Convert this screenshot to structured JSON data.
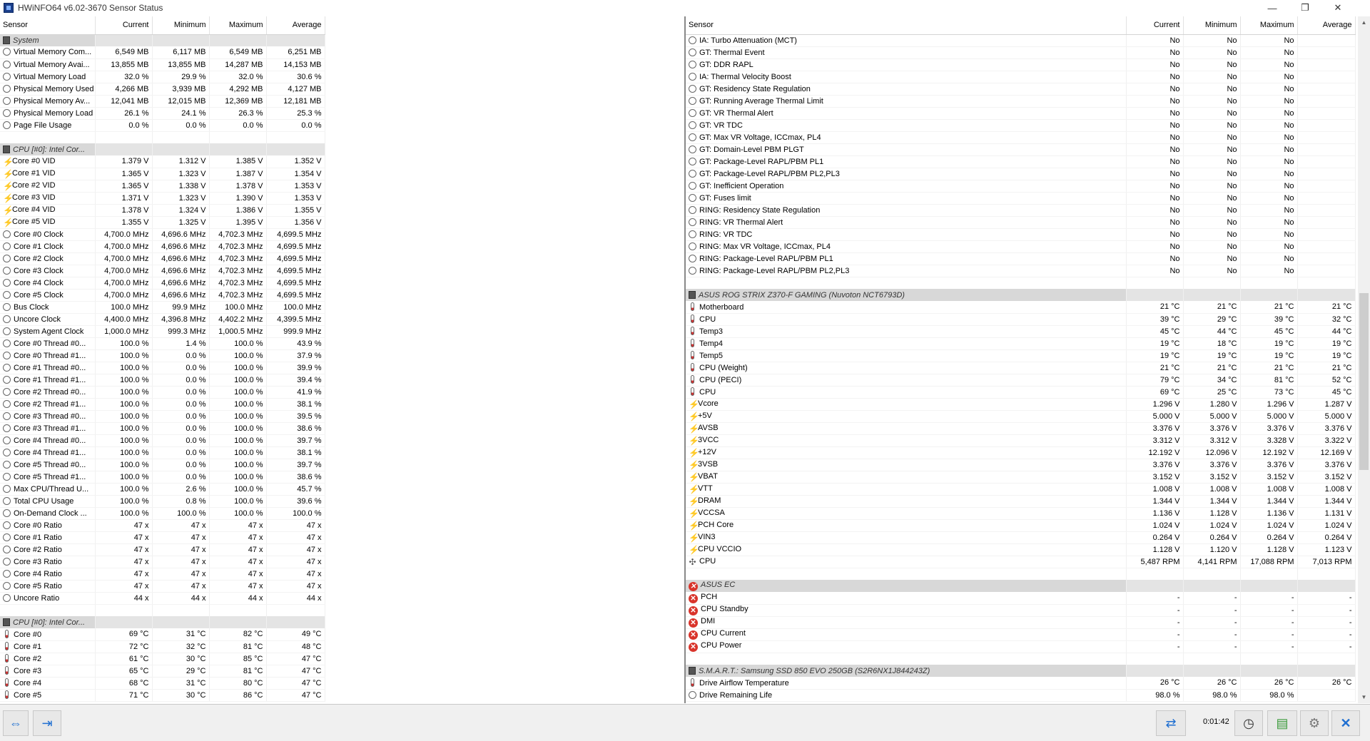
{
  "window": {
    "title": "HWiNFO64 v6.02-3670 Sensor Status",
    "minimize_glyph": "—",
    "maximize_glyph": "❐",
    "close_glyph": "✕"
  },
  "columns": {
    "sensor": "Sensor",
    "current": "Current",
    "minimum": "Minimum",
    "maximum": "Maximum",
    "average": "Average"
  },
  "left_rows": [
    {
      "type": "group",
      "icon": "chip",
      "name": "System"
    },
    {
      "type": "row",
      "icon": "circle",
      "name": "Virtual Memory Com...",
      "cur": "6,549 MB",
      "min": "6,117 MB",
      "max": "6,549 MB",
      "avg": "6,251 MB"
    },
    {
      "type": "row",
      "icon": "circle",
      "name": "Virtual Memory Avai...",
      "cur": "13,855 MB",
      "min": "13,855 MB",
      "max": "14,287 MB",
      "avg": "14,153 MB"
    },
    {
      "type": "row",
      "icon": "circle",
      "name": "Virtual Memory Load",
      "cur": "32.0 %",
      "min": "29.9 %",
      "max": "32.0 %",
      "avg": "30.6 %"
    },
    {
      "type": "row",
      "icon": "circle",
      "name": "Physical Memory Used",
      "cur": "4,266 MB",
      "min": "3,939 MB",
      "max": "4,292 MB",
      "avg": "4,127 MB"
    },
    {
      "type": "row",
      "icon": "circle",
      "name": "Physical Memory Av...",
      "cur": "12,041 MB",
      "min": "12,015 MB",
      "max": "12,369 MB",
      "avg": "12,181 MB"
    },
    {
      "type": "row",
      "icon": "circle",
      "name": "Physical Memory Load",
      "cur": "26.1 %",
      "min": "24.1 %",
      "max": "26.3 %",
      "avg": "25.3 %"
    },
    {
      "type": "row",
      "icon": "circle",
      "name": "Page File Usage",
      "cur": "0.0 %",
      "min": "0.0 %",
      "max": "0.0 %",
      "avg": "0.0 %"
    },
    {
      "type": "blank"
    },
    {
      "type": "group",
      "icon": "chip",
      "name": "CPU [#0]: Intel Cor..."
    },
    {
      "type": "row",
      "icon": "bolt",
      "name": "Core #0 VID",
      "cur": "1.379 V",
      "min": "1.312 V",
      "max": "1.385 V",
      "avg": "1.352 V"
    },
    {
      "type": "row",
      "icon": "bolt",
      "name": "Core #1 VID",
      "cur": "1.365 V",
      "min": "1.323 V",
      "max": "1.387 V",
      "avg": "1.354 V"
    },
    {
      "type": "row",
      "icon": "bolt",
      "name": "Core #2 VID",
      "cur": "1.365 V",
      "min": "1.338 V",
      "max": "1.378 V",
      "avg": "1.353 V"
    },
    {
      "type": "row",
      "icon": "bolt",
      "name": "Core #3 VID",
      "cur": "1.371 V",
      "min": "1.323 V",
      "max": "1.390 V",
      "avg": "1.353 V"
    },
    {
      "type": "row",
      "icon": "bolt",
      "name": "Core #4 VID",
      "cur": "1.378 V",
      "min": "1.324 V",
      "max": "1.386 V",
      "avg": "1.355 V"
    },
    {
      "type": "row",
      "icon": "bolt",
      "name": "Core #5 VID",
      "cur": "1.355 V",
      "min": "1.325 V",
      "max": "1.395 V",
      "avg": "1.356 V"
    },
    {
      "type": "row",
      "icon": "circle",
      "name": "Core #0 Clock",
      "cur": "4,700.0 MHz",
      "min": "4,696.6 MHz",
      "max": "4,702.3 MHz",
      "avg": "4,699.5 MHz"
    },
    {
      "type": "row",
      "icon": "circle",
      "name": "Core #1 Clock",
      "cur": "4,700.0 MHz",
      "min": "4,696.6 MHz",
      "max": "4,702.3 MHz",
      "avg": "4,699.5 MHz"
    },
    {
      "type": "row",
      "icon": "circle",
      "name": "Core #2 Clock",
      "cur": "4,700.0 MHz",
      "min": "4,696.6 MHz",
      "max": "4,702.3 MHz",
      "avg": "4,699.5 MHz"
    },
    {
      "type": "row",
      "icon": "circle",
      "name": "Core #3 Clock",
      "cur": "4,700.0 MHz",
      "min": "4,696.6 MHz",
      "max": "4,702.3 MHz",
      "avg": "4,699.5 MHz"
    },
    {
      "type": "row",
      "icon": "circle",
      "name": "Core #4 Clock",
      "cur": "4,700.0 MHz",
      "min": "4,696.6 MHz",
      "max": "4,702.3 MHz",
      "avg": "4,699.5 MHz"
    },
    {
      "type": "row",
      "icon": "circle",
      "name": "Core #5 Clock",
      "cur": "4,700.0 MHz",
      "min": "4,696.6 MHz",
      "max": "4,702.3 MHz",
      "avg": "4,699.5 MHz"
    },
    {
      "type": "row",
      "icon": "circle",
      "name": "Bus Clock",
      "cur": "100.0 MHz",
      "min": "99.9 MHz",
      "max": "100.0 MHz",
      "avg": "100.0 MHz"
    },
    {
      "type": "row",
      "icon": "circle",
      "name": "Uncore Clock",
      "cur": "4,400.0 MHz",
      "min": "4,396.8 MHz",
      "max": "4,402.2 MHz",
      "avg": "4,399.5 MHz"
    },
    {
      "type": "row",
      "icon": "circle",
      "name": "System Agent Clock",
      "cur": "1,000.0 MHz",
      "min": "999.3 MHz",
      "max": "1,000.5 MHz",
      "avg": "999.9 MHz"
    },
    {
      "type": "row",
      "icon": "circle",
      "name": "Core #0 Thread #0...",
      "cur": "100.0 %",
      "min": "1.4 %",
      "max": "100.0 %",
      "avg": "43.9 %"
    },
    {
      "type": "row",
      "icon": "circle",
      "name": "Core #0 Thread #1...",
      "cur": "100.0 %",
      "min": "0.0 %",
      "max": "100.0 %",
      "avg": "37.9 %"
    },
    {
      "type": "row",
      "icon": "circle",
      "name": "Core #1 Thread #0...",
      "cur": "100.0 %",
      "min": "0.0 %",
      "max": "100.0 %",
      "avg": "39.9 %"
    },
    {
      "type": "row",
      "icon": "circle",
      "name": "Core #1 Thread #1...",
      "cur": "100.0 %",
      "min": "0.0 %",
      "max": "100.0 %",
      "avg": "39.4 %"
    },
    {
      "type": "row",
      "icon": "circle",
      "name": "Core #2 Thread #0...",
      "cur": "100.0 %",
      "min": "0.0 %",
      "max": "100.0 %",
      "avg": "41.9 %"
    },
    {
      "type": "row",
      "icon": "circle",
      "name": "Core #2 Thread #1...",
      "cur": "100.0 %",
      "min": "0.0 %",
      "max": "100.0 %",
      "avg": "38.1 %"
    },
    {
      "type": "row",
      "icon": "circle",
      "name": "Core #3 Thread #0...",
      "cur": "100.0 %",
      "min": "0.0 %",
      "max": "100.0 %",
      "avg": "39.5 %"
    },
    {
      "type": "row",
      "icon": "circle",
      "name": "Core #3 Thread #1...",
      "cur": "100.0 %",
      "min": "0.0 %",
      "max": "100.0 %",
      "avg": "38.6 %"
    },
    {
      "type": "row",
      "icon": "circle",
      "name": "Core #4 Thread #0...",
      "cur": "100.0 %",
      "min": "0.0 %",
      "max": "100.0 %",
      "avg": "39.7 %"
    },
    {
      "type": "row",
      "icon": "circle",
      "name": "Core #4 Thread #1...",
      "cur": "100.0 %",
      "min": "0.0 %",
      "max": "100.0 %",
      "avg": "38.1 %"
    },
    {
      "type": "row",
      "icon": "circle",
      "name": "Core #5 Thread #0...",
      "cur": "100.0 %",
      "min": "0.0 %",
      "max": "100.0 %",
      "avg": "39.7 %"
    },
    {
      "type": "row",
      "icon": "circle",
      "name": "Core #5 Thread #1...",
      "cur": "100.0 %",
      "min": "0.0 %",
      "max": "100.0 %",
      "avg": "38.6 %"
    },
    {
      "type": "row",
      "icon": "circle",
      "name": "Max CPU/Thread U...",
      "cur": "100.0 %",
      "min": "2.6 %",
      "max": "100.0 %",
      "avg": "45.7 %"
    },
    {
      "type": "row",
      "icon": "circle",
      "name": "Total CPU Usage",
      "cur": "100.0 %",
      "min": "0.8 %",
      "max": "100.0 %",
      "avg": "39.6 %"
    },
    {
      "type": "row",
      "icon": "circle",
      "name": "On-Demand Clock ...",
      "cur": "100.0 %",
      "min": "100.0 %",
      "max": "100.0 %",
      "avg": "100.0 %"
    },
    {
      "type": "row",
      "icon": "circle",
      "name": "Core #0 Ratio",
      "cur": "47 x",
      "min": "47 x",
      "max": "47 x",
      "avg": "47 x"
    },
    {
      "type": "row",
      "icon": "circle",
      "name": "Core #1 Ratio",
      "cur": "47 x",
      "min": "47 x",
      "max": "47 x",
      "avg": "47 x"
    },
    {
      "type": "row",
      "icon": "circle",
      "name": "Core #2 Ratio",
      "cur": "47 x",
      "min": "47 x",
      "max": "47 x",
      "avg": "47 x"
    },
    {
      "type": "row",
      "icon": "circle",
      "name": "Core #3 Ratio",
      "cur": "47 x",
      "min": "47 x",
      "max": "47 x",
      "avg": "47 x"
    },
    {
      "type": "row",
      "icon": "circle",
      "name": "Core #4 Ratio",
      "cur": "47 x",
      "min": "47 x",
      "max": "47 x",
      "avg": "47 x"
    },
    {
      "type": "row",
      "icon": "circle",
      "name": "Core #5 Ratio",
      "cur": "47 x",
      "min": "47 x",
      "max": "47 x",
      "avg": "47 x"
    },
    {
      "type": "row",
      "icon": "circle",
      "name": "Uncore Ratio",
      "cur": "44 x",
      "min": "44 x",
      "max": "44 x",
      "avg": "44 x"
    },
    {
      "type": "blank"
    },
    {
      "type": "group",
      "icon": "chip",
      "name": "CPU [#0]: Intel Cor..."
    },
    {
      "type": "row",
      "icon": "therm",
      "name": "Core #0",
      "cur": "69 °C",
      "min": "31 °C",
      "max": "82 °C",
      "avg": "49 °C"
    },
    {
      "type": "row",
      "icon": "therm",
      "name": "Core #1",
      "cur": "72 °C",
      "min": "32 °C",
      "max": "81 °C",
      "avg": "48 °C"
    },
    {
      "type": "row",
      "icon": "therm",
      "name": "Core #2",
      "cur": "61 °C",
      "min": "30 °C",
      "max": "85 °C",
      "avg": "47 °C"
    },
    {
      "type": "row",
      "icon": "therm",
      "name": "Core #3",
      "cur": "65 °C",
      "min": "29 °C",
      "max": "81 °C",
      "avg": "47 °C"
    },
    {
      "type": "row",
      "icon": "therm",
      "name": "Core #4",
      "cur": "68 °C",
      "min": "31 °C",
      "max": "80 °C",
      "avg": "47 °C"
    },
    {
      "type": "row",
      "icon": "therm",
      "name": "Core #5",
      "cur": "71 °C",
      "min": "30 °C",
      "max": "86 °C",
      "avg": "47 °C"
    }
  ],
  "right_rows": [
    {
      "type": "row",
      "icon": "circle",
      "name": "IA: Turbo Attenuation (MCT)",
      "cur": "No",
      "min": "No",
      "max": "No",
      "avg": ""
    },
    {
      "type": "row",
      "icon": "circle",
      "name": "GT: Thermal Event",
      "cur": "No",
      "min": "No",
      "max": "No",
      "avg": ""
    },
    {
      "type": "row",
      "icon": "circle",
      "name": "GT: DDR RAPL",
      "cur": "No",
      "min": "No",
      "max": "No",
      "avg": ""
    },
    {
      "type": "row",
      "icon": "circle",
      "name": "IA: Thermal Velocity Boost",
      "cur": "No",
      "min": "No",
      "max": "No",
      "avg": ""
    },
    {
      "type": "row",
      "icon": "circle",
      "name": "GT: Residency State Regulation",
      "cur": "No",
      "min": "No",
      "max": "No",
      "avg": ""
    },
    {
      "type": "row",
      "icon": "circle",
      "name": "GT: Running Average Thermal Limit",
      "cur": "No",
      "min": "No",
      "max": "No",
      "avg": ""
    },
    {
      "type": "row",
      "icon": "circle",
      "name": "GT: VR Thermal Alert",
      "cur": "No",
      "min": "No",
      "max": "No",
      "avg": ""
    },
    {
      "type": "row",
      "icon": "circle",
      "name": "GT: VR TDC",
      "cur": "No",
      "min": "No",
      "max": "No",
      "avg": ""
    },
    {
      "type": "row",
      "icon": "circle",
      "name": "GT: Max VR Voltage, ICCmax, PL4",
      "cur": "No",
      "min": "No",
      "max": "No",
      "avg": ""
    },
    {
      "type": "row",
      "icon": "circle",
      "name": "GT: Domain-Level PBM PLGT",
      "cur": "No",
      "min": "No",
      "max": "No",
      "avg": ""
    },
    {
      "type": "row",
      "icon": "circle",
      "name": "GT: Package-Level RAPL/PBM PL1",
      "cur": "No",
      "min": "No",
      "max": "No",
      "avg": ""
    },
    {
      "type": "row",
      "icon": "circle",
      "name": "GT: Package-Level RAPL/PBM PL2,PL3",
      "cur": "No",
      "min": "No",
      "max": "No",
      "avg": ""
    },
    {
      "type": "row",
      "icon": "circle",
      "name": "GT: Inefficient Operation",
      "cur": "No",
      "min": "No",
      "max": "No",
      "avg": ""
    },
    {
      "type": "row",
      "icon": "circle",
      "name": "GT: Fuses limit",
      "cur": "No",
      "min": "No",
      "max": "No",
      "avg": ""
    },
    {
      "type": "row",
      "icon": "circle",
      "name": "RING: Residency State Regulation",
      "cur": "No",
      "min": "No",
      "max": "No",
      "avg": ""
    },
    {
      "type": "row",
      "icon": "circle",
      "name": "RING: VR Thermal Alert",
      "cur": "No",
      "min": "No",
      "max": "No",
      "avg": ""
    },
    {
      "type": "row",
      "icon": "circle",
      "name": "RING: VR TDC",
      "cur": "No",
      "min": "No",
      "max": "No",
      "avg": ""
    },
    {
      "type": "row",
      "icon": "circle",
      "name": "RING: Max VR Voltage, ICCmax, PL4",
      "cur": "No",
      "min": "No",
      "max": "No",
      "avg": ""
    },
    {
      "type": "row",
      "icon": "circle",
      "name": "RING: Package-Level RAPL/PBM PL1",
      "cur": "No",
      "min": "No",
      "max": "No",
      "avg": ""
    },
    {
      "type": "row",
      "icon": "circle",
      "name": "RING: Package-Level RAPL/PBM PL2,PL3",
      "cur": "No",
      "min": "No",
      "max": "No",
      "avg": ""
    },
    {
      "type": "blank"
    },
    {
      "type": "group",
      "icon": "chip",
      "name": "ASUS ROG STRIX Z370-F GAMING (Nuvoton NCT6793D)"
    },
    {
      "type": "row",
      "icon": "therm",
      "name": "Motherboard",
      "cur": "21 °C",
      "min": "21 °C",
      "max": "21 °C",
      "avg": "21 °C"
    },
    {
      "type": "row",
      "icon": "therm",
      "name": "CPU",
      "cur": "39 °C",
      "min": "29 °C",
      "max": "39 °C",
      "avg": "32 °C"
    },
    {
      "type": "row",
      "icon": "therm",
      "name": "Temp3",
      "cur": "45 °C",
      "min": "44 °C",
      "max": "45 °C",
      "avg": "44 °C"
    },
    {
      "type": "row",
      "icon": "therm",
      "name": "Temp4",
      "cur": "19 °C",
      "min": "18 °C",
      "max": "19 °C",
      "avg": "19 °C"
    },
    {
      "type": "row",
      "icon": "therm",
      "name": "Temp5",
      "cur": "19 °C",
      "min": "19 °C",
      "max": "19 °C",
      "avg": "19 °C"
    },
    {
      "type": "row",
      "icon": "therm",
      "name": "CPU (Weight)",
      "cur": "21 °C",
      "min": "21 °C",
      "max": "21 °C",
      "avg": "21 °C"
    },
    {
      "type": "row",
      "icon": "therm",
      "name": "CPU (PECI)",
      "cur": "79 °C",
      "min": "34 °C",
      "max": "81 °C",
      "avg": "52 °C"
    },
    {
      "type": "row",
      "icon": "therm",
      "name": "CPU",
      "cur": "69 °C",
      "min": "25 °C",
      "max": "73 °C",
      "avg": "45 °C"
    },
    {
      "type": "row",
      "icon": "bolt",
      "name": "Vcore",
      "cur": "1.296 V",
      "min": "1.280 V",
      "max": "1.296 V",
      "avg": "1.287 V"
    },
    {
      "type": "row",
      "icon": "bolt",
      "name": "+5V",
      "cur": "5.000 V",
      "min": "5.000 V",
      "max": "5.000 V",
      "avg": "5.000 V"
    },
    {
      "type": "row",
      "icon": "bolt",
      "name": "AVSB",
      "cur": "3.376 V",
      "min": "3.376 V",
      "max": "3.376 V",
      "avg": "3.376 V"
    },
    {
      "type": "row",
      "icon": "bolt",
      "name": "3VCC",
      "cur": "3.312 V",
      "min": "3.312 V",
      "max": "3.328 V",
      "avg": "3.322 V"
    },
    {
      "type": "row",
      "icon": "bolt",
      "name": "+12V",
      "cur": "12.192 V",
      "min": "12.096 V",
      "max": "12.192 V",
      "avg": "12.169 V"
    },
    {
      "type": "row",
      "icon": "bolt",
      "name": "3VSB",
      "cur": "3.376 V",
      "min": "3.376 V",
      "max": "3.376 V",
      "avg": "3.376 V"
    },
    {
      "type": "row",
      "icon": "bolt",
      "name": "VBAT",
      "cur": "3.152 V",
      "min": "3.152 V",
      "max": "3.152 V",
      "avg": "3.152 V"
    },
    {
      "type": "row",
      "icon": "bolt",
      "name": "VTT",
      "cur": "1.008 V",
      "min": "1.008 V",
      "max": "1.008 V",
      "avg": "1.008 V"
    },
    {
      "type": "row",
      "icon": "bolt",
      "name": "DRAM",
      "cur": "1.344 V",
      "min": "1.344 V",
      "max": "1.344 V",
      "avg": "1.344 V"
    },
    {
      "type": "row",
      "icon": "bolt",
      "name": "VCCSA",
      "cur": "1.136 V",
      "min": "1.128 V",
      "max": "1.136 V",
      "avg": "1.131 V"
    },
    {
      "type": "row",
      "icon": "bolt",
      "name": "PCH Core",
      "cur": "1.024 V",
      "min": "1.024 V",
      "max": "1.024 V",
      "avg": "1.024 V"
    },
    {
      "type": "row",
      "icon": "bolt",
      "name": "VIN3",
      "cur": "0.264 V",
      "min": "0.264 V",
      "max": "0.264 V",
      "avg": "0.264 V"
    },
    {
      "type": "row",
      "icon": "bolt",
      "name": "CPU VCCIO",
      "cur": "1.128 V",
      "min": "1.120 V",
      "max": "1.128 V",
      "avg": "1.123 V"
    },
    {
      "type": "row",
      "icon": "fan",
      "name": "CPU",
      "cur": "5,487 RPM",
      "min": "4,141 RPM",
      "max": "17,088 RPM",
      "avg": "7,013 RPM"
    },
    {
      "type": "blank"
    },
    {
      "type": "group",
      "icon": "x",
      "name": "ASUS EC"
    },
    {
      "type": "row",
      "icon": "x",
      "name": "PCH",
      "cur": "-",
      "min": "-",
      "max": "-",
      "avg": "-"
    },
    {
      "type": "row",
      "icon": "x",
      "name": "CPU Standby",
      "cur": "-",
      "min": "-",
      "max": "-",
      "avg": "-"
    },
    {
      "type": "row",
      "icon": "x",
      "name": "DMI",
      "cur": "-",
      "min": "-",
      "max": "-",
      "avg": "-"
    },
    {
      "type": "row",
      "icon": "x",
      "name": "CPU Current",
      "cur": "-",
      "min": "-",
      "max": "-",
      "avg": "-"
    },
    {
      "type": "row",
      "icon": "x",
      "name": "CPU Power",
      "cur": "-",
      "min": "-",
      "max": "-",
      "avg": "-"
    },
    {
      "type": "blank"
    },
    {
      "type": "group",
      "icon": "chip",
      "name": "S.M.A.R.T.: Samsung SSD 850 EVO 250GB (S2R6NX1J844243Z)"
    },
    {
      "type": "row",
      "icon": "therm",
      "name": "Drive Airflow Temperature",
      "cur": "26 °C",
      "min": "26 °C",
      "max": "26 °C",
      "avg": "26 °C"
    },
    {
      "type": "row",
      "icon": "circle",
      "name": "Drive Remaining Life",
      "cur": "98.0 %",
      "min": "98.0 %",
      "max": "98.0 %",
      "avg": ""
    }
  ],
  "toolbar": {
    "timer": "0:01:42"
  },
  "colors": {
    "accent": "#1f6fd1",
    "group_bg": "#e4e4e4",
    "bolt": "#e0a800",
    "error": "#d9342b"
  },
  "icons": {
    "chip": "chip-icon",
    "circle": "sensor-circle-icon",
    "bolt": "voltage-bolt-icon",
    "therm": "thermometer-icon",
    "fan": "fan-icon",
    "x": "error-x-icon"
  }
}
